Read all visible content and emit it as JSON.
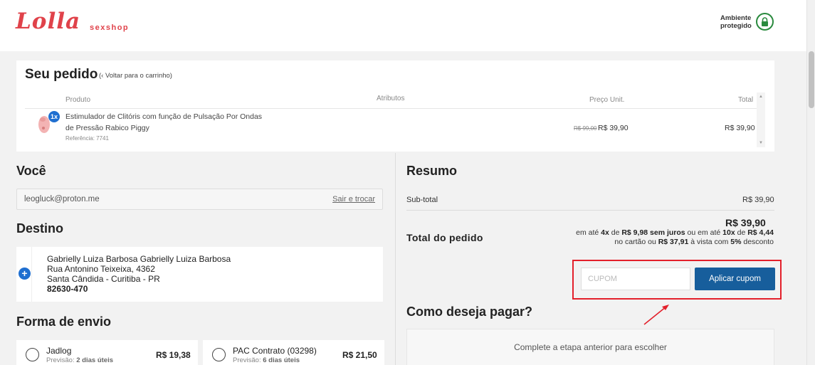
{
  "header": {
    "logo_text": "Lolla",
    "logo_sub": "sexshop",
    "secure_line1": "Ambiente",
    "secure_line2": "protegido",
    "secure_icon": "lock-icon",
    "colors": {
      "brand": "#e0424a",
      "secure": "#2a8a3e"
    }
  },
  "order": {
    "title": "Seu pedido",
    "back_link": "(‹ Voltar para o carrinho)",
    "columns": [
      "Produto",
      "Atributos",
      "Preço Unit.",
      "Total"
    ],
    "items": [
      {
        "quantity": "1x",
        "name": "Estimulador de Clitóris com função de Pulsação Por Ondas de Pressão Rabico Piggy",
        "reference": "Referência: 7741",
        "old_price": "R$ 99,00",
        "unit_price": "R$ 39,90",
        "total": "R$ 39,90"
      }
    ]
  },
  "customer": {
    "title": "Você",
    "email": "leogluck@proton.me",
    "logout_label": "Sair e trocar"
  },
  "destination": {
    "title": "Destino",
    "add_icon": "plus-icon",
    "name": "Gabrielly Luiza Barbosa Gabrielly Luiza Barbosa",
    "street": "Rua Antonino Teixeixa, 4362",
    "district": "Santa Cândida - Curitiba - PR",
    "zip": "82630-470"
  },
  "shipping": {
    "title": "Forma de envio",
    "options": [
      {
        "name": "Jadlog",
        "days_prefix": "Previsão:",
        "days": "2 dias úteis",
        "price": "R$ 19,38"
      },
      {
        "name": "PAC Contrato (03298)",
        "days_prefix": "Previsão:",
        "days": "6 dias úteis",
        "price": "R$ 21,50"
      }
    ]
  },
  "summary": {
    "title": "Resumo",
    "subtotal_label": "Sub-total",
    "subtotal_value": "R$ 39,90",
    "total_label": "Total do pedido",
    "total_value": "R$ 39,90",
    "installments": {
      "t1": "em até ",
      "b1": "4x",
      "t2": " de ",
      "b2": "R$ 9,98 sem juros",
      "t3": " ou em até ",
      "b3": "10x",
      "t4": " de ",
      "b4": "R$ 4,44",
      "t5": " no cartão ou ",
      "b5": "R$ 37,91",
      "t6": " à vista com ",
      "b6": "5%",
      "t7": " desconto"
    },
    "coupon_placeholder": "CUPOM",
    "coupon_button": "Aplicar cupom",
    "highlight_color": "#e3202b",
    "button_color": "#175e9c"
  },
  "payment": {
    "title": "Como deseja pagar?",
    "message": "Complete a etapa anterior para escolher"
  }
}
